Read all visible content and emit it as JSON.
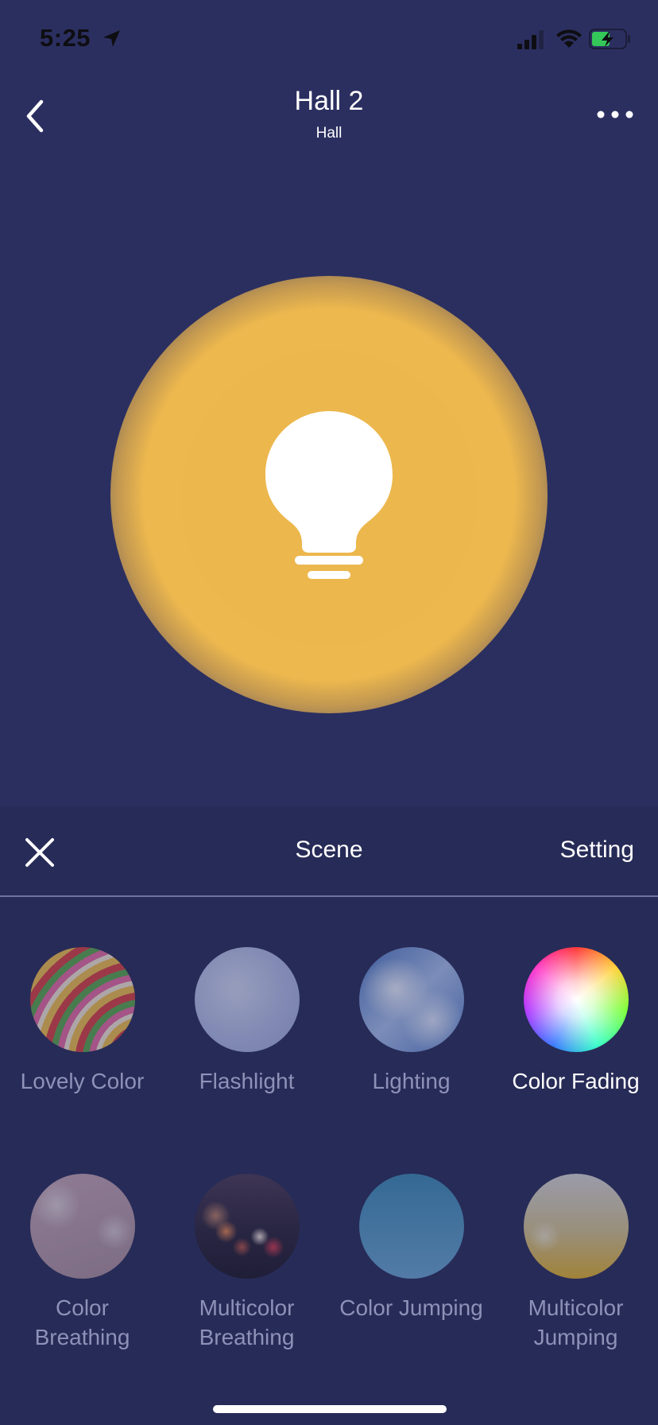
{
  "status_bar": {
    "time": "5:25"
  },
  "header": {
    "title": "Hall 2",
    "subtitle": "Hall"
  },
  "bulb": {
    "color": "#ECB74D"
  },
  "panel": {
    "tabs": {
      "scene": "Scene",
      "setting": "Setting"
    },
    "scenes": [
      {
        "label": "Lovely Color",
        "icon": "lovely-color-thumbnail",
        "selected": false
      },
      {
        "label": "Flashlight",
        "icon": "flashlight-thumbnail",
        "selected": false
      },
      {
        "label": "Lighting",
        "icon": "lighting-thumbnail",
        "selected": false
      },
      {
        "label": "Color Fading",
        "icon": "color-fading-thumbnail",
        "selected": true
      },
      {
        "label": "Color\nBreathing",
        "icon": "color-breathing-thumbnail",
        "selected": false
      },
      {
        "label": "Multicolor\nBreathing",
        "icon": "multicolor-breathing-thumbnail",
        "selected": false
      },
      {
        "label": "Color Jumping",
        "icon": "color-jumping-thumbnail",
        "selected": false
      },
      {
        "label": "Multicolor\nJumping",
        "icon": "multicolor-jumping-thumbnail",
        "selected": false
      }
    ]
  },
  "colors": {
    "background": "#2B2F60",
    "panel": "#272B57",
    "accent": "#ECB74D",
    "inactive_text": "#8E92B9"
  }
}
